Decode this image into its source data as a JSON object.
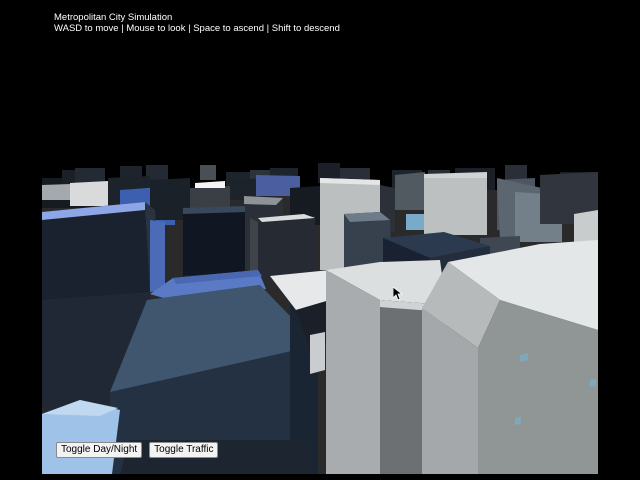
{
  "hud": {
    "title": "Metropolitan City Simulation",
    "instructions": "WASD to move | Mouse to look | Space to ascend | Shift to descend"
  },
  "controls": {
    "day_night_label": "Toggle Day/Night",
    "traffic_label": "Toggle Traffic"
  },
  "colors": {
    "sky": "#000000",
    "ground": "#2a2a2a",
    "building_light": "#b9bdbd",
    "building_dark": "#1c222b",
    "building_blue": "#5a7fc9",
    "window_highlight": "#79aaca"
  }
}
